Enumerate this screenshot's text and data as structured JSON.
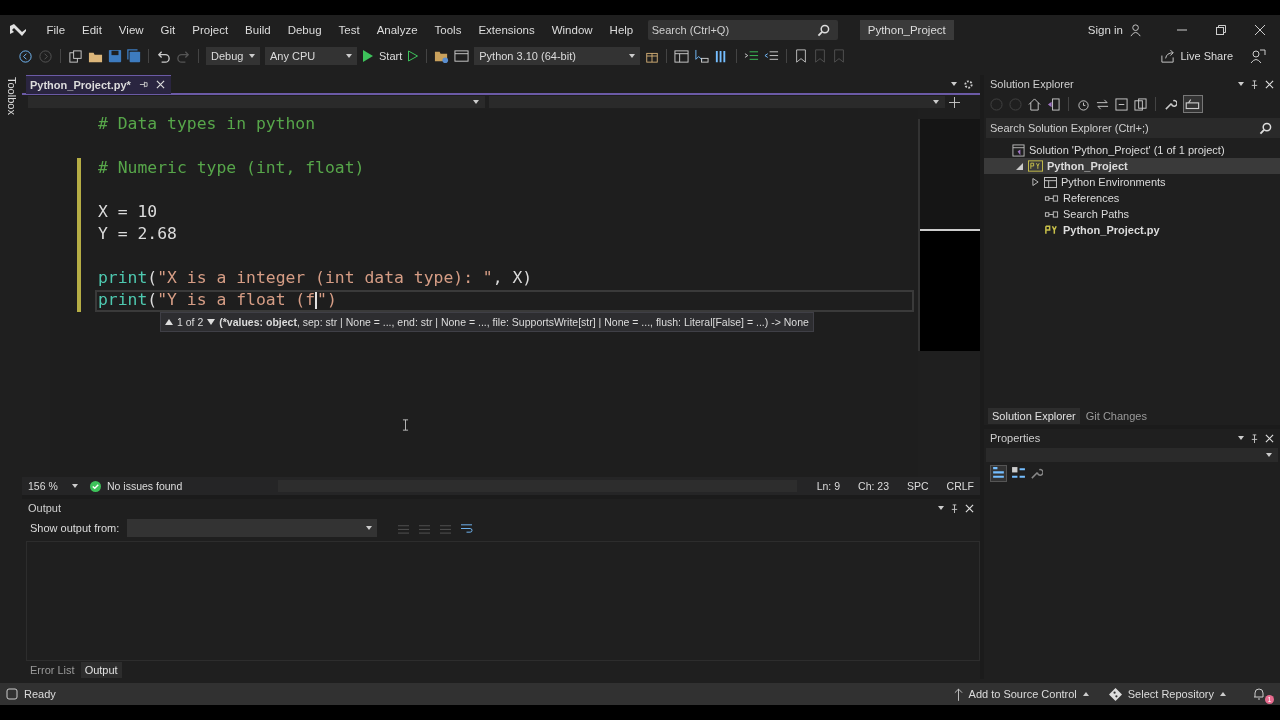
{
  "menu_bar": {
    "items": [
      "File",
      "Edit",
      "View",
      "Git",
      "Project",
      "Build",
      "Debug",
      "Test",
      "Analyze",
      "Tools",
      "Extensions",
      "Window",
      "Help"
    ],
    "search": {
      "placeholder": "Search (Ctrl+Q)"
    },
    "solution_name": "Python_Project",
    "sign_in": "Sign in"
  },
  "toolbar": {
    "configuration": "Debug",
    "platform": "Any CPU",
    "start": "Start",
    "environment": "Python 3.10 (64-bit)",
    "live_share": "Live Share"
  },
  "toolbox": {
    "label": "Toolbox"
  },
  "document_tabs": [
    {
      "label": "Python_Project.py*",
      "selected": true
    }
  ],
  "editor": {
    "lines": [
      {
        "kind": "code",
        "changed": false,
        "current": false,
        "tokens": [
          {
            "kind": "comment",
            "text": "# Data types in python"
          }
        ]
      },
      {
        "kind": "blank"
      },
      {
        "kind": "code",
        "changed": true,
        "current": false,
        "tokens": [
          {
            "kind": "comment",
            "text": "# Numeric type (int, float)"
          }
        ]
      },
      {
        "kind": "blank",
        "changed": true
      },
      {
        "kind": "code",
        "changed": true,
        "current": false,
        "tokens": [
          {
            "kind": "plain",
            "text": "X = 10"
          }
        ]
      },
      {
        "kind": "code",
        "changed": true,
        "current": false,
        "tokens": [
          {
            "kind": "plain",
            "text": "Y = 2.68"
          }
        ]
      },
      {
        "kind": "blank",
        "changed": true
      },
      {
        "kind": "code",
        "changed": true,
        "current": false,
        "tokens": [
          {
            "kind": "function",
            "text": "print"
          },
          {
            "kind": "plain",
            "text": "("
          },
          {
            "kind": "string",
            "text": "\"X is a integer (int data type): \""
          },
          {
            "kind": "plain",
            "text": ", X)"
          }
        ]
      },
      {
        "kind": "code",
        "changed": true,
        "current": true,
        "tokens": [
          {
            "kind": "function",
            "text": "print"
          },
          {
            "kind": "plain",
            "text": "("
          },
          {
            "kind": "string",
            "text": "\"Y is a float (f"
          },
          {
            "kind": "caret"
          },
          {
            "kind": "string",
            "text": "\")"
          }
        ]
      }
    ],
    "signature_help": {
      "counter": "1 of 2",
      "bold": "(*values: object",
      "rest": ", sep: str | None = ..., end: str | None = ..., file: SupportsWrite[str] | None = ..., flush: Literal[False] = ...) -> None"
    },
    "status": {
      "zoom": "156 %",
      "issues": "No issues found",
      "line": "Ln: 9",
      "column": "Ch: 23",
      "indent": "SPC",
      "line_ending": "CRLF"
    }
  },
  "output": {
    "title": "Output",
    "show_from_label": "Show output from:"
  },
  "bottom_tabs": [
    {
      "label": "Error List",
      "selected": false
    },
    {
      "label": "Output",
      "selected": true
    }
  ],
  "solution_explorer": {
    "title": "Solution Explorer",
    "search": {
      "placeholder": "Search Solution Explorer (Ctrl+;)"
    },
    "tree": [
      {
        "label": "Solution 'Python_Project' (1 of 1 project)",
        "kind": "solution",
        "startup": false,
        "selected": false,
        "children": [
          {
            "label": "Python_Project",
            "kind": "project",
            "startup": true,
            "selected": true,
            "expanded": true,
            "children": [
              {
                "label": "Python Environments",
                "kind": "environments",
                "startup": false,
                "selected": false,
                "expanded": false
              },
              {
                "label": "References",
                "kind": "reference",
                "startup": false,
                "selected": false
              },
              {
                "label": "Search Paths",
                "kind": "reference",
                "startup": false,
                "selected": false
              },
              {
                "label": "Python_Project.py",
                "kind": "file",
                "startup": true,
                "selected": false
              }
            ]
          }
        ]
      }
    ]
  },
  "right_tabs": [
    {
      "label": "Solution Explorer",
      "selected": true
    },
    {
      "label": "Git Changes",
      "selected": false
    }
  ],
  "properties": {
    "title": "Properties"
  },
  "status_bar": {
    "state": "Ready",
    "source_control": "Add to Source Control",
    "repository": "Select Repository",
    "notifications": "1"
  }
}
